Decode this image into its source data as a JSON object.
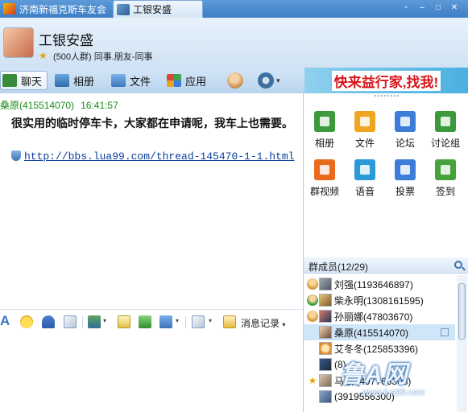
{
  "tabs": [
    {
      "label": "济南新福克斯车友会"
    },
    {
      "label": "工银安盛"
    }
  ],
  "window_controls": {
    "restore": "▫",
    "minimize": "–",
    "maximize": "□",
    "close": "✕"
  },
  "header": {
    "group_name": "工银安盛",
    "group_info": "(500人群) 同事.朋友-同事",
    "star": "★"
  },
  "toolbar": {
    "chat": "聊天",
    "album": "相册",
    "file": "文件",
    "apps": "应用",
    "caret": "▾"
  },
  "banner": {
    "text": "快来益行家,找我!"
  },
  "message": {
    "sender": "桑原(415514070)",
    "time": "16:41:57",
    "text": "很实用的临时停车卡，大家都在申请呢，我车上也需要。",
    "link": "http://bbs.lua99.com/thread-145470-1-1.html"
  },
  "input_tools": {
    "font": "A",
    "history": "消息记录",
    "caret": "▾"
  },
  "apps_panel": [
    {
      "label": "相册",
      "icon": "album-icon"
    },
    {
      "label": "文件",
      "icon": "folder-icon"
    },
    {
      "label": "论坛",
      "icon": "forum-icon"
    },
    {
      "label": "讨论组",
      "icon": "discussion-icon"
    },
    {
      "label": "群视频",
      "icon": "video-icon"
    },
    {
      "label": "语音",
      "icon": "voice-icon"
    },
    {
      "label": "投票",
      "icon": "vote-icon"
    },
    {
      "label": "签到",
      "icon": "checkin-icon"
    }
  ],
  "members": {
    "title": "群成员(12/29)",
    "list": [
      {
        "name": "刘强(1193646897)"
      },
      {
        "name": "柴永明(1308161595)"
      },
      {
        "name": "孙丽娜(47803670)"
      },
      {
        "name": "桑原(415514070)"
      },
      {
        "name": "艾冬冬(125853396)"
      },
      {
        "name": "(8)"
      },
      {
        "name": "马歌 (497766308)"
      },
      {
        "name": "(3919556300)"
      }
    ]
  },
  "watermark": {
    "logo": "鲁A网",
    "url": "www.lua99.com"
  }
}
